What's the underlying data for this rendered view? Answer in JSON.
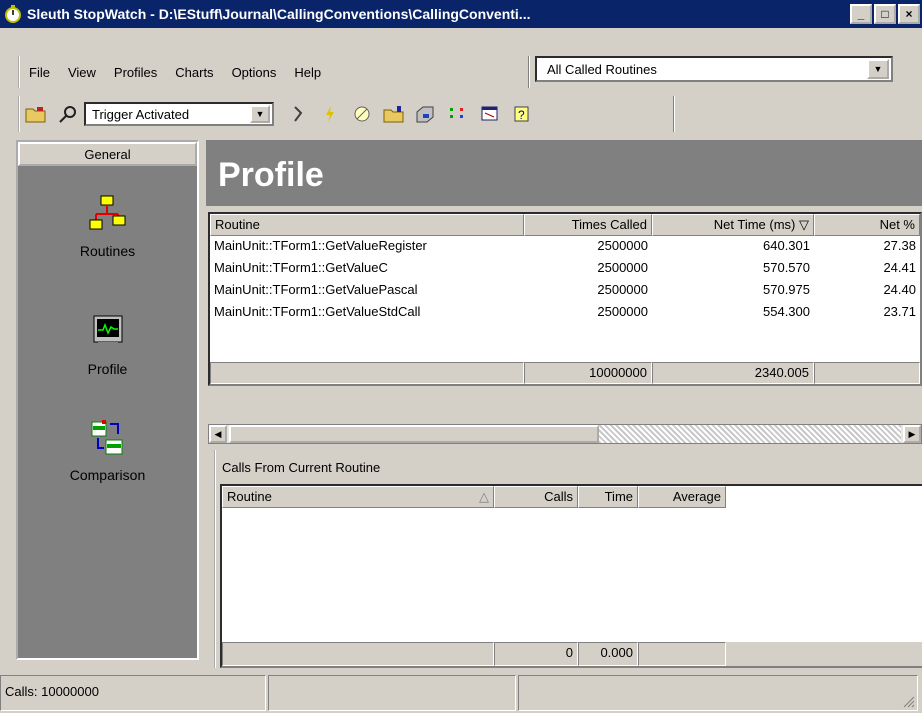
{
  "window": {
    "title": "Sleuth StopWatch - D:\\EStuff\\Journal\\CallingConventions\\CallingConventi...",
    "minimize": "_",
    "maximize": "□",
    "close": "×"
  },
  "menu": {
    "items": [
      "File",
      "View",
      "Profiles",
      "Charts",
      "Options",
      "Help"
    ]
  },
  "routine_filter": {
    "value": "All Called Routines"
  },
  "toolbar": {
    "trigger_value": "Trigger Activated",
    "dropdown_arrow": "▼"
  },
  "sidebar": {
    "header": "General",
    "items": [
      {
        "label": "Routines",
        "icon": "routines-icon"
      },
      {
        "label": "Profile",
        "icon": "profile-icon"
      },
      {
        "label": "Comparison",
        "icon": "comparison-icon"
      }
    ]
  },
  "profile": {
    "heading": "Profile",
    "columns": [
      "Routine",
      "Times Called",
      "Net Time (ms) ▽",
      "Net %"
    ],
    "rows": [
      {
        "routine": "MainUnit::TForm1::GetValueRegister",
        "calls": "2500000",
        "net_time": "640.301",
        "net_pct": "27.38"
      },
      {
        "routine": "MainUnit::TForm1::GetValueC",
        "calls": "2500000",
        "net_time": "570.570",
        "net_pct": "24.41"
      },
      {
        "routine": "MainUnit::TForm1::GetValuePascal",
        "calls": "2500000",
        "net_time": "570.975",
        "net_pct": "24.40"
      },
      {
        "routine": "MainUnit::TForm1::GetValueStdCall",
        "calls": "2500000",
        "net_time": "554.300",
        "net_pct": "23.71"
      }
    ],
    "totals": {
      "calls": "10000000",
      "net_time": "2340.005"
    }
  },
  "calls_from": {
    "title": "Calls From Current Routine",
    "columns": [
      "Routine",
      "Calls",
      "Time",
      "Average"
    ],
    "totals": {
      "calls": "0",
      "time": "0.000"
    }
  },
  "status": {
    "calls": "Calls: 10000000"
  }
}
